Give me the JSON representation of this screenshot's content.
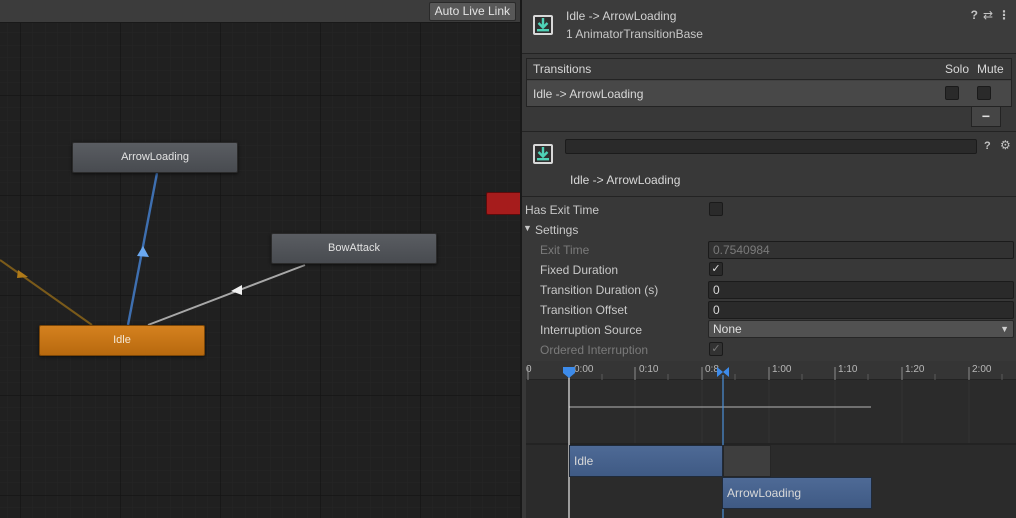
{
  "graph": {
    "auto_live_link": "Auto Live Link",
    "states": {
      "arrow_loading": "ArrowLoading",
      "bow_attack": "BowAttack",
      "idle": "Idle"
    }
  },
  "inspector": {
    "title": "Idle -> ArrowLoading",
    "subtitle": "1 AnimatorTransitionBase",
    "header_icons": {
      "help": "?",
      "presets": "⇄",
      "menu": "⋮"
    },
    "transitions": {
      "header": "Transitions",
      "solo": "Solo",
      "mute": "Mute",
      "rows": [
        {
          "label": "Idle -> ArrowLoading",
          "solo": false,
          "mute": false
        }
      ],
      "remove_label": "−"
    },
    "transition": {
      "name_value": "",
      "caption": "Idle -> ArrowLoading",
      "icons": {
        "help": "?",
        "settings": "⚙"
      }
    },
    "props": {
      "has_exit_time_label": "Has Exit Time",
      "has_exit_time": false,
      "settings_label": "Settings",
      "exit_time_label": "Exit Time",
      "exit_time": "0.7540984",
      "fixed_duration_label": "Fixed Duration",
      "fixed_duration": true,
      "transition_duration_label": "Transition Duration (s)",
      "transition_duration": "0",
      "transition_offset_label": "Transition Offset",
      "transition_offset": "0",
      "interruption_source_label": "Interruption Source",
      "interruption_source": "None",
      "ordered_interruption_label": "Ordered Interruption",
      "ordered_interruption": true
    },
    "timeline": {
      "ticks": [
        "0",
        "0:00",
        "0:10",
        "0:8",
        "1:00",
        "1:10",
        "1:20",
        "2:00"
      ],
      "clips": {
        "from": "Idle",
        "to": "ArrowLoading"
      }
    }
  },
  "colors": {
    "default_state": "#c8751a",
    "accent_blue": "#4a8fd8",
    "clip_blue": "#46618d",
    "red_node": "#a61c1c"
  },
  "icons": {
    "asset": "download-arrow-icon",
    "check": "checkmark-icon",
    "dropdown": "triangle-down-icon"
  }
}
